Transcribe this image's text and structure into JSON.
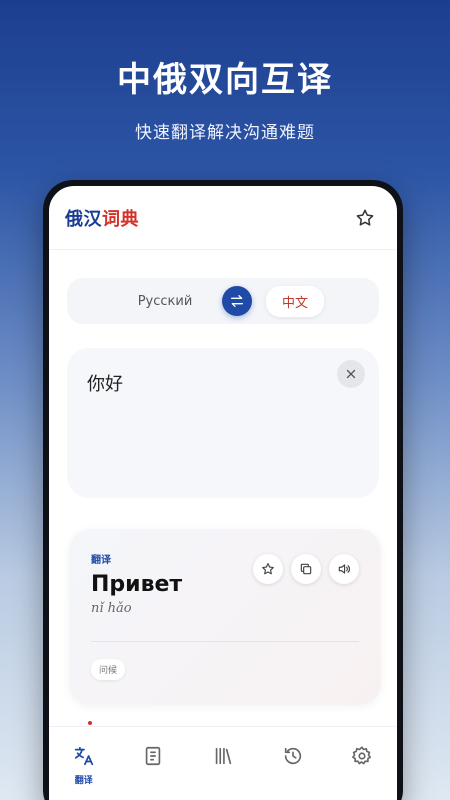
{
  "promo": {
    "headline": "中俄双向互译",
    "subline": "快速翻译解决沟通难题"
  },
  "app": {
    "title_part1": "俄汉",
    "title_part2": "词典"
  },
  "language_bar": {
    "source": "Русский",
    "target": "中文"
  },
  "input": {
    "text": "你好"
  },
  "result": {
    "label": "翻译",
    "word": "Привет",
    "pinyin": "nǐ hǎo",
    "chip": "问候"
  },
  "tabs": [
    {
      "label": "翻译",
      "icon": "translate-icon",
      "active": true
    },
    {
      "label": "",
      "icon": "book-icon"
    },
    {
      "label": "",
      "icon": "library-icon"
    },
    {
      "label": "",
      "icon": "history-icon"
    },
    {
      "label": "",
      "icon": "gear-icon"
    }
  ],
  "colors": {
    "brand_blue": "#1f4aa6",
    "brand_red": "#d4322a"
  }
}
